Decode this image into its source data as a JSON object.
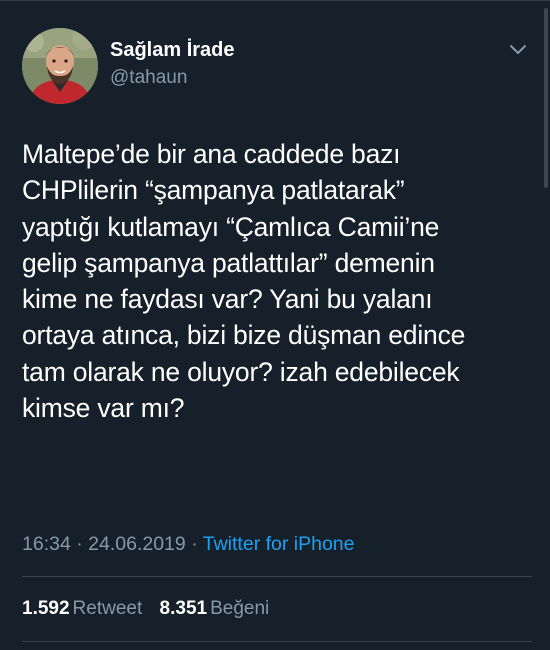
{
  "tweet": {
    "display_name": "Sağlam İrade",
    "username": "@tahaun",
    "text": "Maltepe’de bir ana caddede bazı\nCHPlilerin “şampanya patlatarak”\nyaptığı kutlamayı “Çamlıca Camii’ne\ngelip şampanya patlattılar” demenin\nkime ne faydası var? Yani bu yalanı\nortaya atınca, bizi bize düşman edince\ntam olarak ne oluyor? izah edebilecek\nkimse var mı?",
    "time": "16:34",
    "date": "24.06.2019",
    "separator": "·",
    "source": "Twitter for iPhone"
  },
  "stats": {
    "retweets_count": "1.592",
    "retweets_label": "Retweet",
    "likes_count": "8.351",
    "likes_label": "Beğeni"
  },
  "icons": {
    "avatar": "user-avatar-photo",
    "menu": "chevron-down-icon"
  },
  "colors": {
    "background": "#15202b",
    "primary_text": "#ffffff",
    "secondary_text": "#8899a6",
    "link": "#1da1f2",
    "divider": "#38444d"
  }
}
